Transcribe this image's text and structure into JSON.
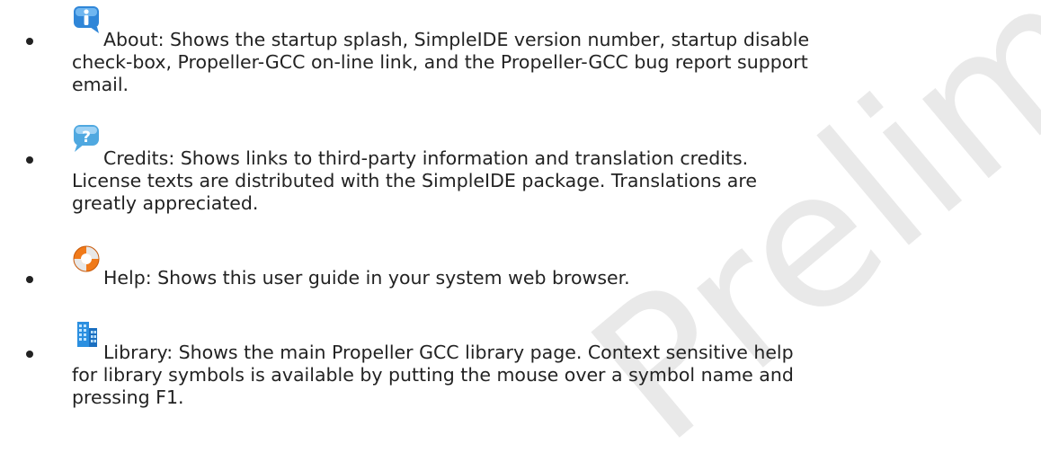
{
  "watermark": {
    "text": "Preliminary",
    "color": "#e9e9e9"
  },
  "items": [
    {
      "icon": "info-icon",
      "lines": [
        "About: Shows the startup splash, SimpleIDE version number, startup disable",
        "check-box, Propeller-GCC on-line link, and the Propeller-GCC bug report support",
        "email."
      ]
    },
    {
      "icon": "question-bubble-icon",
      "lines": [
        "Credits: Shows links to third-party information and translation credits.",
        "License texts are distributed with the SimpleIDE package. Translations are",
        "greatly appreciated."
      ]
    },
    {
      "icon": "lifebuoy-icon",
      "lines": [
        "Help: Shows this user guide in your system web browser."
      ]
    },
    {
      "icon": "library-building-icon",
      "lines": [
        "Library: Shows the main Propeller GCC library page. Context sensitive help",
        "for library symbols is available by putting the mouse over a symbol name and",
        "pressing F1."
      ]
    }
  ],
  "colors": {
    "text": "#222222",
    "info_blue": "#2f86d8",
    "question_blue": "#4fa8e0",
    "lifebuoy_orange": "#f07a1a",
    "building_blue": "#2b8fe0"
  }
}
